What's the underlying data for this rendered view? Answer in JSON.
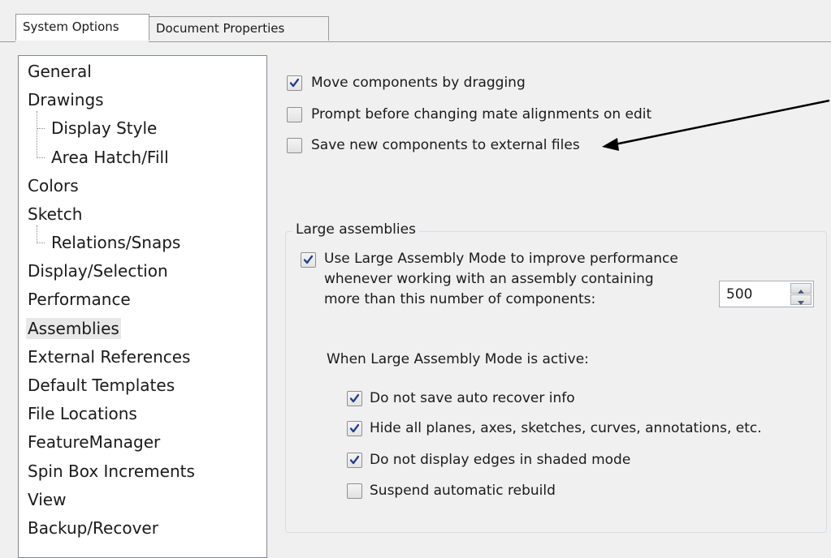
{
  "tabs": {
    "system_options": "System Options",
    "document_properties": "Document Properties"
  },
  "tree": {
    "items": [
      "General",
      "Drawings",
      "Display Style",
      "Area Hatch/Fill",
      "Colors",
      "Sketch",
      "Relations/Snaps",
      "Display/Selection",
      "Performance",
      "Assemblies",
      "External References",
      "Default Templates",
      "File Locations",
      "FeatureManager",
      "Spin Box Increments",
      "View",
      "Backup/Recover"
    ],
    "selected": "Assemblies"
  },
  "options": {
    "move_components": {
      "label": "Move components by dragging",
      "checked": true
    },
    "prompt_mate": {
      "label": "Prompt before changing mate alignments on edit",
      "checked": false
    },
    "save_external": {
      "label": "Save new components to external files",
      "checked": false
    }
  },
  "large_assemblies": {
    "title": "Large assemblies",
    "use_mode": {
      "line1": "Use Large Assembly Mode to improve performance",
      "line2": "whenever working with an assembly containing",
      "line3": "more than this number of components:",
      "checked": true
    },
    "threshold": "500",
    "active_heading": "When Large Assembly Mode is active:",
    "no_autorecover": {
      "label": "Do not save auto recover info",
      "checked": true
    },
    "hide_planes": {
      "label": "Hide all planes, axes, sketches, curves, annotations, etc.",
      "checked": true
    },
    "no_edges": {
      "label": "Do not display edges in shaded mode",
      "checked": true
    },
    "suspend_rebuild": {
      "label": "Suspend automatic rebuild",
      "checked": false
    }
  }
}
